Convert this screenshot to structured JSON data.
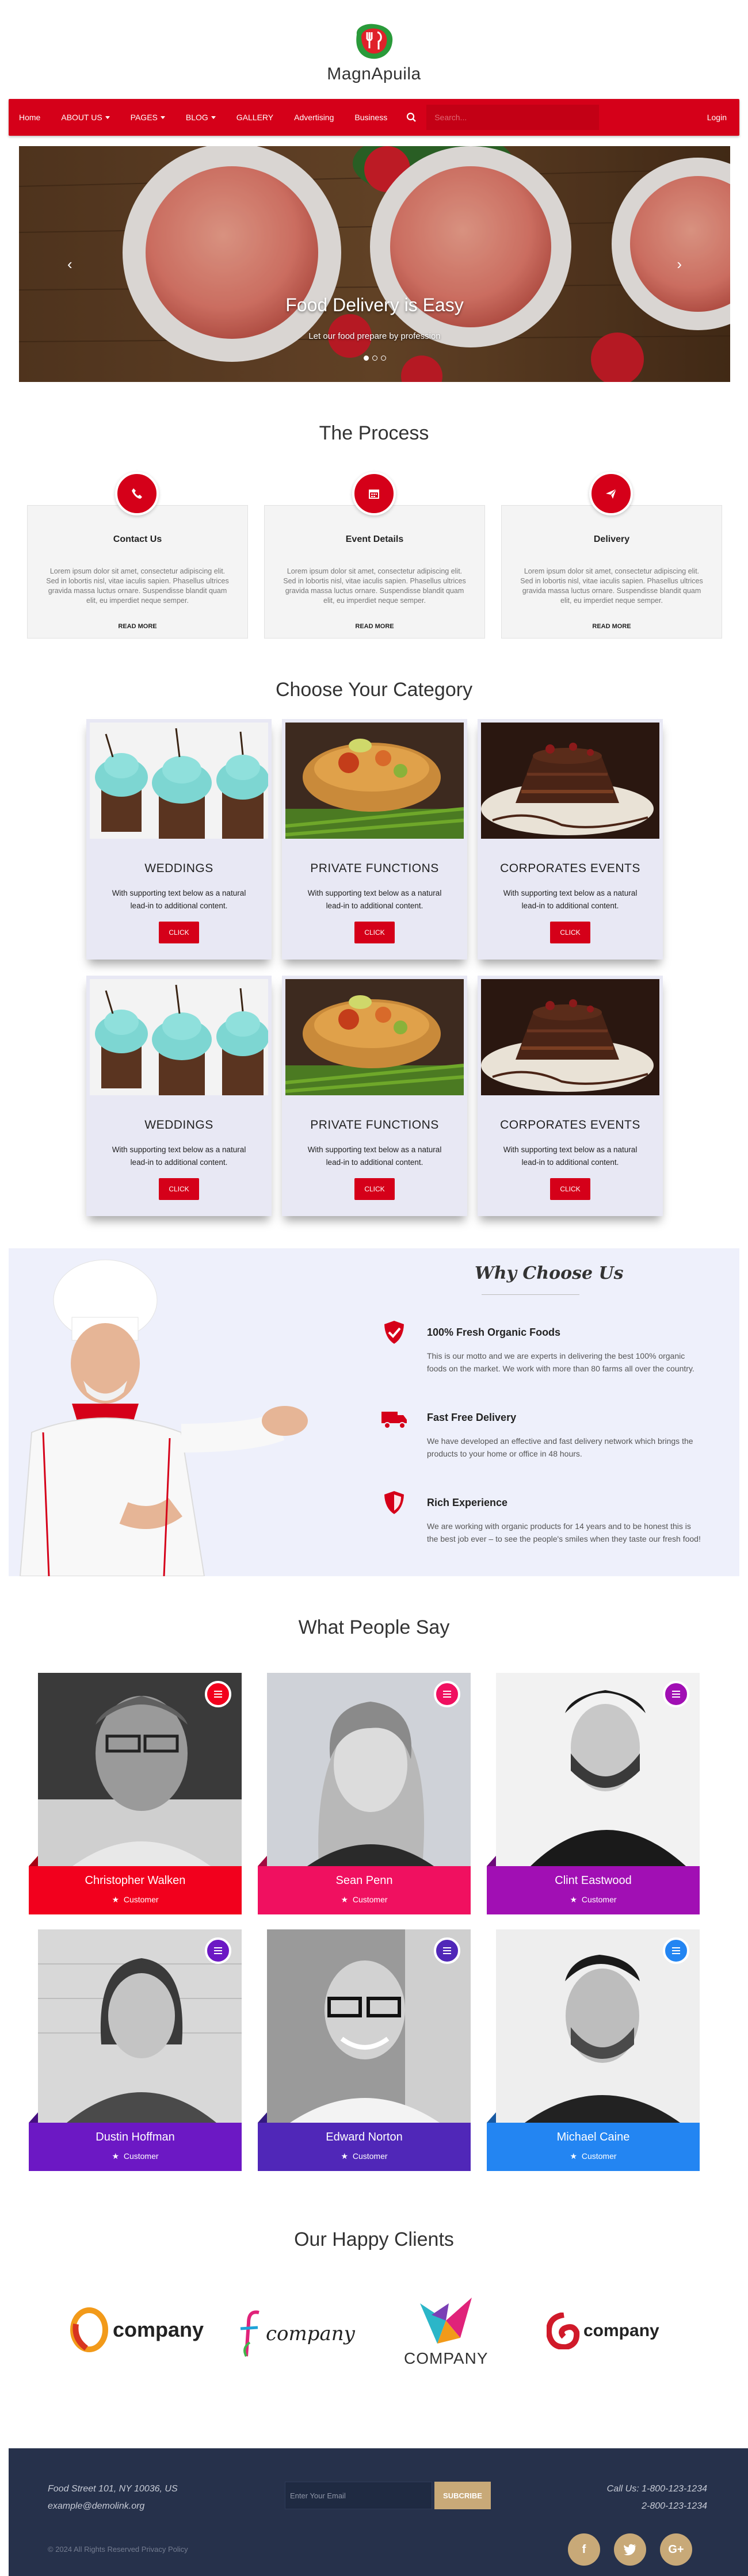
{
  "brand": {
    "name": "MagnApuila"
  },
  "nav": {
    "items": [
      {
        "label": "Home",
        "has_caret": false
      },
      {
        "label": "ABOUT US",
        "has_caret": true
      },
      {
        "label": "PAGES",
        "has_caret": true
      },
      {
        "label": "BLOG",
        "has_caret": true
      },
      {
        "label": "GALLERY",
        "has_caret": false
      },
      {
        "label": "Advertising",
        "has_caret": false
      },
      {
        "label": "Business",
        "has_caret": false
      }
    ],
    "search_placeholder": "Search...",
    "login_label": "Login",
    "color": "#d50019"
  },
  "hero": {
    "title": "Food Delivery is Easy",
    "subtitle": "Let our food prepare by profession",
    "slides": 3,
    "active_slide": 0
  },
  "process": {
    "title": "The Process",
    "cards": [
      {
        "icon": "phone-icon",
        "title": "Contact Us",
        "text": "Lorem ipsum dolor sit amet, consectetur adipiscing elit. Sed in lobortis nisl, vitae iaculis sapien. Phasellus ultrices gravida massa luctus ornare. Suspendisse blandit quam elit, eu imperdiet neque semper.",
        "more": "READ MORE"
      },
      {
        "icon": "calendar-icon",
        "title": "Event Details",
        "text": "Lorem ipsum dolor sit amet, consectetur adipiscing elit. Sed in lobortis nisl, vitae iaculis sapien. Phasellus ultrices gravida massa luctus ornare. Suspendisse blandit quam elit, eu imperdiet neque semper.",
        "more": "READ MORE"
      },
      {
        "icon": "paper-plane-icon",
        "title": "Delivery",
        "text": "Lorem ipsum dolor sit amet, consectetur adipiscing elit. Sed in lobortis nisl, vitae iaculis sapien. Phasellus ultrices gravida massa luctus ornare. Suspendisse blandit quam elit, eu imperdiet neque semper.",
        "more": "READ MORE"
      }
    ]
  },
  "categories": {
    "title": "Choose Your Category",
    "cards": [
      {
        "image": "cupcakes",
        "title": "WEDDINGS",
        "text": "With supporting text below as a natural lead-in to additional content.",
        "button": "CLICK"
      },
      {
        "image": "pie",
        "title": "PRIVATE FUNCTIONS",
        "text": "With supporting text below as a natural lead-in to additional content.",
        "button": "CLICK"
      },
      {
        "image": "chocolate-cake",
        "title": "CORPORATES EVENTS",
        "text": "With supporting text below as a natural lead-in to additional content.",
        "button": "CLICK"
      },
      {
        "image": "cupcakes",
        "title": "WEDDINGS",
        "text": "With supporting text below as a natural lead-in to additional content.",
        "button": "CLICK"
      },
      {
        "image": "pie",
        "title": "PRIVATE FUNCTIONS",
        "text": "With supporting text below as a natural lead-in to additional content.",
        "button": "CLICK"
      },
      {
        "image": "chocolate-cake",
        "title": "CORPORATES EVENTS",
        "text": "With supporting text below as a natural lead-in to additional content.",
        "button": "CLICK"
      }
    ]
  },
  "why": {
    "title": "Why Choose Us",
    "items": [
      {
        "icon": "shield-check-icon",
        "title": "100% Fresh Organic Foods",
        "text": "This is our motto and we are experts in delivering the best 100% organic foods on the market. We work with more than 80 farms all over the country."
      },
      {
        "icon": "truck-icon",
        "title": "Fast Free Delivery",
        "text": "We have developed an effective and fast delivery network which brings the products to your home or office in 48 hours."
      },
      {
        "icon": "shield-plus-icon",
        "title": "Rich Experience",
        "text": "We are working with organic products for 14 years and to be honest this is the best job ever – to see the people's smiles when they taste our fresh food!"
      }
    ]
  },
  "testimonials": {
    "title": "What People Say",
    "people": [
      {
        "name": "Christopher Walken",
        "role": "Customer",
        "color": "#f2001d",
        "fold": "#a50013"
      },
      {
        "name": "Sean Penn",
        "role": "Customer",
        "color": "#f01060",
        "fold": "#a20a40"
      },
      {
        "name": "Clint Eastwood",
        "role": "Customer",
        "color": "#a10fb4",
        "fold": "#6c0a79"
      },
      {
        "name": "Dustin Hoffman",
        "role": "Customer",
        "color": "#6c18c4",
        "fold": "#460f80"
      },
      {
        "name": "Edward Norton",
        "role": "Customer",
        "color": "#5027b8",
        "fold": "#341980"
      },
      {
        "name": "Michael Caine",
        "role": "Customer",
        "color": "#2385f2",
        "fold": "#1759a3"
      }
    ]
  },
  "clients": {
    "title": "Our Happy Clients",
    "logos": [
      {
        "text": "company",
        "style": "ring"
      },
      {
        "text": "company",
        "style": "f-script"
      },
      {
        "text": "COMPANY",
        "style": "origami"
      },
      {
        "text": "company",
        "style": "swirl"
      }
    ]
  },
  "footer": {
    "address": "Food Street 101, NY 10036, US",
    "email": "example@demolink.org",
    "email_placeholder": "Enter Your Email",
    "subscribe": "SUBCRIBE",
    "call": "Call Us: 1-800-123-1234",
    "call2": "2-800-123-1234",
    "copyright": "© 2024 All Rights Reserved Privacy Policy",
    "social": [
      "f",
      "twitter",
      "G+"
    ]
  }
}
